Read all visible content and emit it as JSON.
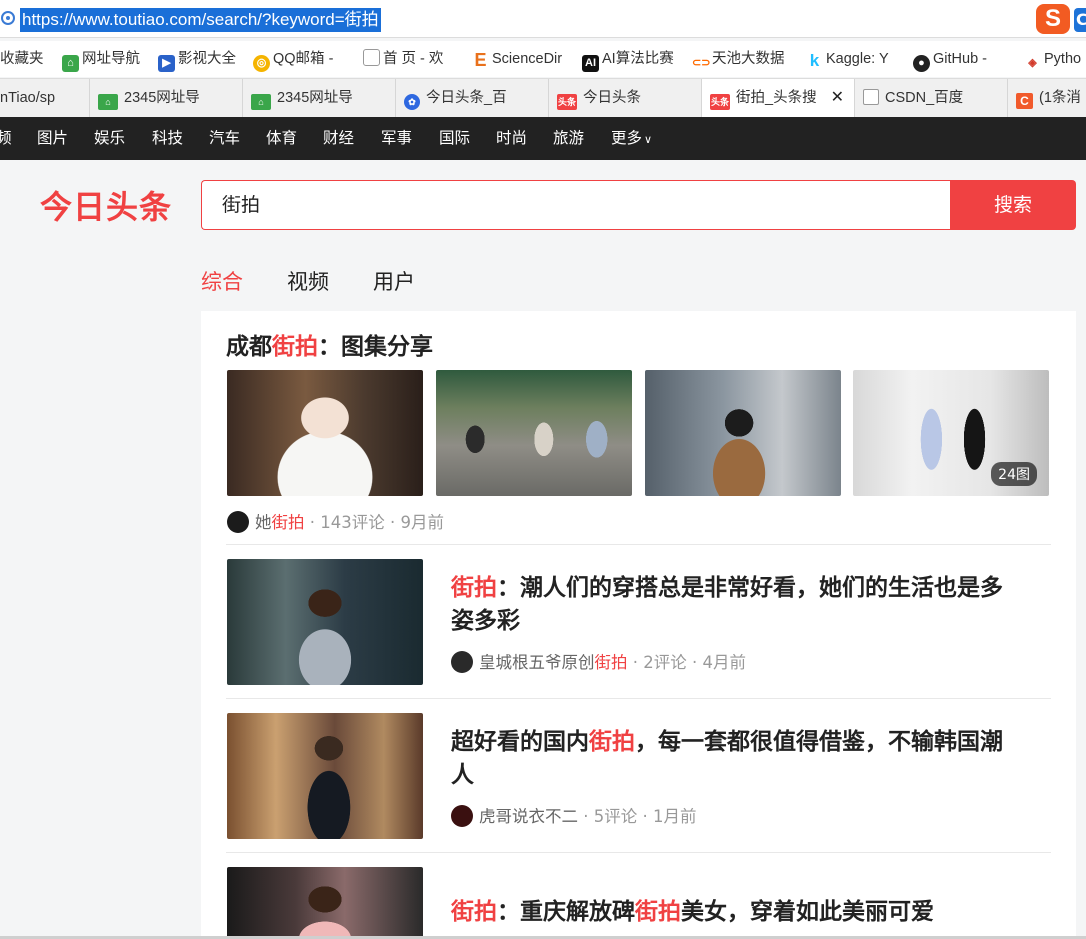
{
  "browser": {
    "url": "https://www.toutiao.com/search/?keyword=街拍",
    "logo_letter": "S",
    "logo_letter2": "C"
  },
  "bookmarks": [
    {
      "label": "收藏夹",
      "icon": "folder-icon"
    },
    {
      "label": "网址导航",
      "icon": "2345-icon"
    },
    {
      "label": "影视大全",
      "icon": "film-icon"
    },
    {
      "label": "QQ邮箱 -",
      "icon": "qq-icon"
    },
    {
      "label": "首 页 - 欢",
      "icon": "page-icon"
    },
    {
      "label": "ScienceDir",
      "icon": "elsevier-icon"
    },
    {
      "label": "AI算法比赛",
      "icon": "ai-icon"
    },
    {
      "label": "天池大数据",
      "icon": "tianchi-icon"
    },
    {
      "label": "Kaggle: Y",
      "icon": "kaggle-icon"
    },
    {
      "label": "GitHub -",
      "icon": "github-icon"
    },
    {
      "label": "Pytho",
      "icon": "python-icon"
    }
  ],
  "tabs": [
    {
      "label": "nTiao/sp"
    },
    {
      "label": "2345网址导"
    },
    {
      "label": "2345网址导"
    },
    {
      "label": "今日头条_百"
    },
    {
      "label": "今日头条"
    },
    {
      "label": "街拍_头条搜",
      "active": true
    },
    {
      "label": "CSDN_百度"
    },
    {
      "label": "(1条消"
    }
  ],
  "tab_icon_text": {
    "toutiao": "头条",
    "csdn": "C"
  },
  "channels": [
    "频",
    "图片",
    "娱乐",
    "科技",
    "汽车",
    "体育",
    "财经",
    "军事",
    "国际",
    "时尚",
    "旅游",
    "更多"
  ],
  "site": {
    "logo": "今日头条",
    "search_value": "街拍",
    "search_button": "搜索"
  },
  "search_tabs": [
    {
      "label": "综合",
      "active": true
    },
    {
      "label": "视频"
    },
    {
      "label": "用户"
    }
  ],
  "gallery": {
    "title_pre": "成都",
    "title_hl": "街拍",
    "title_post": "：图集分享",
    "badge": "24图",
    "meta": {
      "src_pre": "她",
      "src_hl": "街拍",
      "rest": " · 143评论 · 9月前"
    }
  },
  "results": [
    {
      "title_line1_hl": "街拍",
      "title_line1_post": "：潮人们的穿搭总是非常好看，她们的生活也是多",
      "title_line2": "姿多彩",
      "meta": {
        "src_pre": "皇城根五爷原创",
        "src_hl": "街拍",
        "rest": " · 2评论 · 4月前"
      }
    },
    {
      "title_line1_pre": "超好看的国内",
      "title_line1_hl": "街拍",
      "title_line1_post": "，每一套都很值得借鉴，不输韩国潮",
      "title_line2": "人",
      "meta": {
        "src": "虎哥说衣不二",
        "rest": " · 5评论 · 1月前"
      }
    },
    {
      "title_hl1": "街拍",
      "title_mid": "：重庆解放碑",
      "title_hl2": "街拍",
      "title_post": "美女，穿着如此美丽可爱"
    }
  ]
}
